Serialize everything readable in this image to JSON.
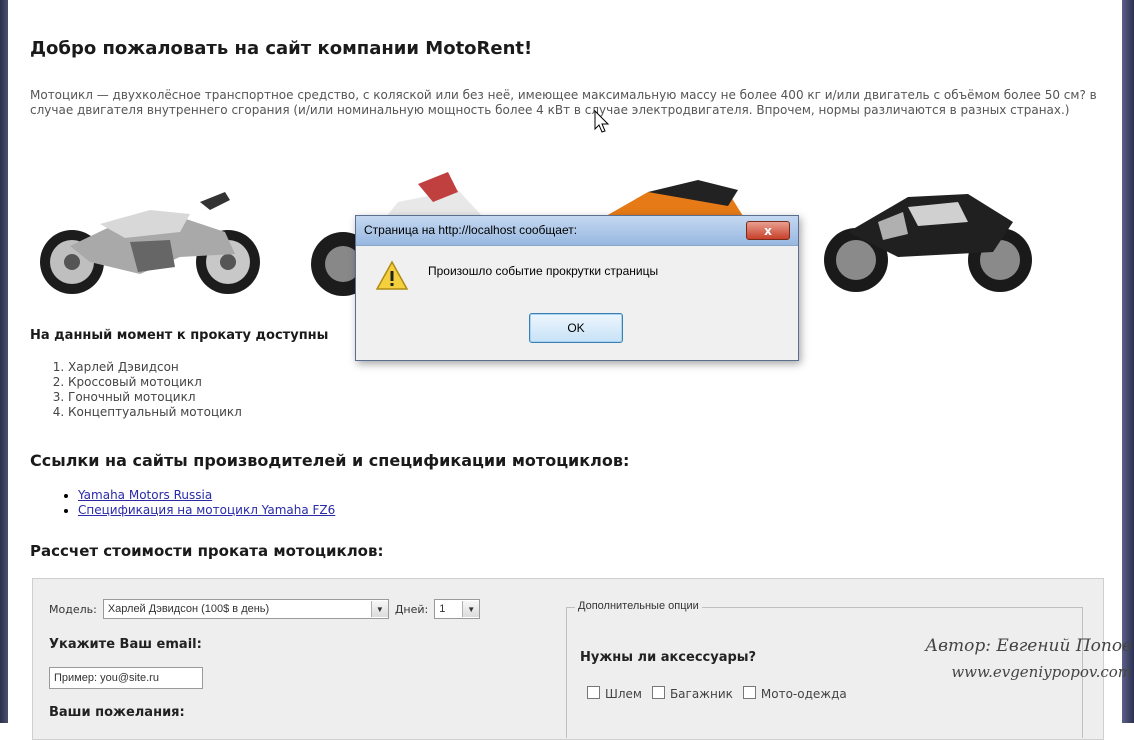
{
  "page": {
    "welcome_title": "Добро пожаловать на сайт компании MotoRent!",
    "intro": "Мотоцикл — двухколёсное транспортное средство, с коляской или без неё, имеющее максимальную массу не более 400 кг и/или двигатель с объёмом более 50 см? в случае двигателя внутреннего сгорания (и/или номинальную мощность более 4 кВт в случае электродвигателя. Впрочем, нормы различаются в разных странах.)",
    "available_heading": "На данный момент к прокату доступны",
    "motorcycles": [
      "Харлей Дэвидсон",
      "Кроссовый мотоцикл",
      "Гоночный мотоцикл",
      "Концептуальный мотоцикл"
    ],
    "links_heading": "Ссылки на сайты производителей и спецификации мотоциклов:",
    "links": [
      "Yamaha Motors Russia",
      "Спецификация на мотоцикл Yamaha FZ6"
    ],
    "calc_heading": "Рассчет стоимости проката мотоциклов:"
  },
  "form": {
    "model_label": "Модель:",
    "model_value": "Харлей Дэвидсон (100$ в день)",
    "days_label": "Дней:",
    "days_value": "1",
    "email_label": "Укажите Ваш email:",
    "email_placeholder": "Пример: you@site.ru",
    "wishes_label": "Ваши пожелания:",
    "extra_legend": "Дополнительные опции",
    "accessories_question": "Нужны ли аксессуары?",
    "accessories": [
      "Шлем",
      "Багажник",
      "Мото-одежда"
    ]
  },
  "watermark": {
    "author": "Автор: Евгений Попов",
    "site": "www.evgeniypopov.com"
  },
  "dialog": {
    "title": "Страница на http://localhost сообщает:",
    "message": "Произошло событие прокрутки страницы",
    "ok_label": "OK",
    "close_label": "x"
  },
  "colors": {
    "link": "#2a2aa8",
    "dialog_title_bg": "#98b8e0",
    "close_button": "#c8402a",
    "form_bg": "#eeeeee"
  }
}
